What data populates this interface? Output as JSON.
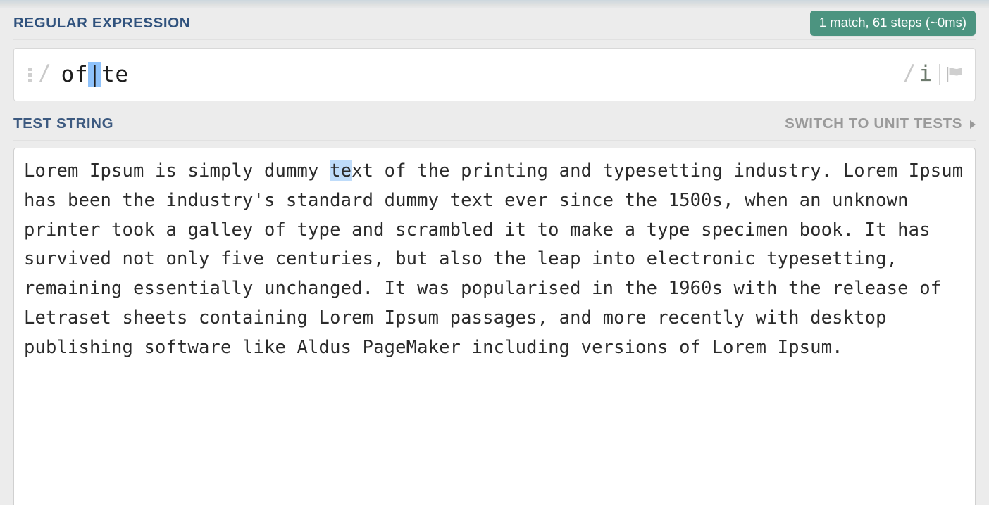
{
  "regex_section": {
    "title": "REGULAR EXPRESSION",
    "badge": "1 match, 61 steps (~0ms)",
    "badge_color": "#4c9480",
    "delimiter_open": "/",
    "delimiter_close": "/",
    "pattern_before_selection": "of",
    "pattern_selection": "|",
    "pattern_after_selection": "te",
    "pattern_full": "of|te",
    "flags": "i",
    "flag_icon": "flag-icon",
    "drag_handle_icon": "drag-handle-icon",
    "selection_color": "#8ec2fb"
  },
  "test_section": {
    "title": "TEST STRING",
    "switch_label": "SWITCH TO UNIT TESTS",
    "switch_arrow_icon": "chevron-right-icon",
    "content_before_match": "Lorem Ipsum is simply dummy ",
    "content_match": "te",
    "content_after_match": "xt of the printing and typesetting industry. Lorem Ipsum has been the industry's standard dummy text ever since the 1500s, when an unknown printer took a galley of type and scrambled it to make a type specimen book. It has survived not only five centuries, but also the leap into electronic typesetting, remaining essentially unchanged. It was popularised in the 1960s with the release of Letraset sheets containing Lorem Ipsum passages, and more recently with desktop publishing software like Aldus PageMaker including versions of Lorem Ipsum.",
    "match_highlight_color": "#bfdcfa"
  }
}
